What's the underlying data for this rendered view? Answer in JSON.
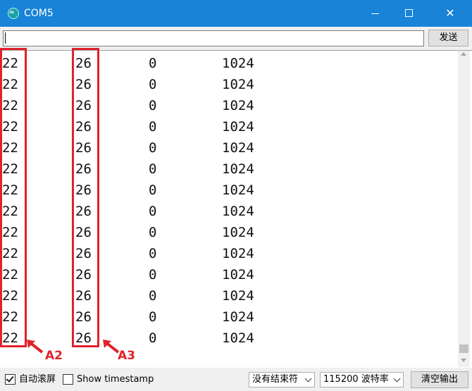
{
  "window": {
    "title": "COM5",
    "icon": "arduino-infinity-icon"
  },
  "controls": {
    "minimize_icon": "minimize-icon",
    "maximize_icon": "maximize-icon",
    "close_icon": "close-icon",
    "close_glyph": "✕"
  },
  "send": {
    "input_value": "",
    "button_label": "发送"
  },
  "output": {
    "lines": [
      [
        "22",
        "26",
        "0",
        "1024"
      ],
      [
        "22",
        "26",
        "0",
        "1024"
      ],
      [
        "22",
        "26",
        "0",
        "1024"
      ],
      [
        "22",
        "26",
        "0",
        "1024"
      ],
      [
        "22",
        "26",
        "0",
        "1024"
      ],
      [
        "22",
        "26",
        "0",
        "1024"
      ],
      [
        "22",
        "26",
        "0",
        "1024"
      ],
      [
        "22",
        "26",
        "0",
        "1024"
      ],
      [
        "22",
        "26",
        "0",
        "1024"
      ],
      [
        "22",
        "26",
        "0",
        "1024"
      ],
      [
        "22",
        "26",
        "0",
        "1024"
      ],
      [
        "22",
        "26",
        "0",
        "1024"
      ],
      [
        "22",
        "26",
        "0",
        "1024"
      ],
      [
        "22",
        "26",
        "0",
        "1024"
      ]
    ]
  },
  "annotations": {
    "a2_label": "A2",
    "a3_label": "A3",
    "color": "#e0232b"
  },
  "bottom": {
    "autoscroll_label": "自动滚屏",
    "autoscroll_checked": true,
    "timestamp_label": "Show timestamp",
    "timestamp_checked": false,
    "line_ending": "没有结束符",
    "baud_rate": "115200 波特率",
    "clear_label": "清空输出"
  },
  "colors": {
    "titlebar": "#1883d7",
    "window_bg": "#f0f0f0",
    "output_bg": "#ffffff"
  }
}
